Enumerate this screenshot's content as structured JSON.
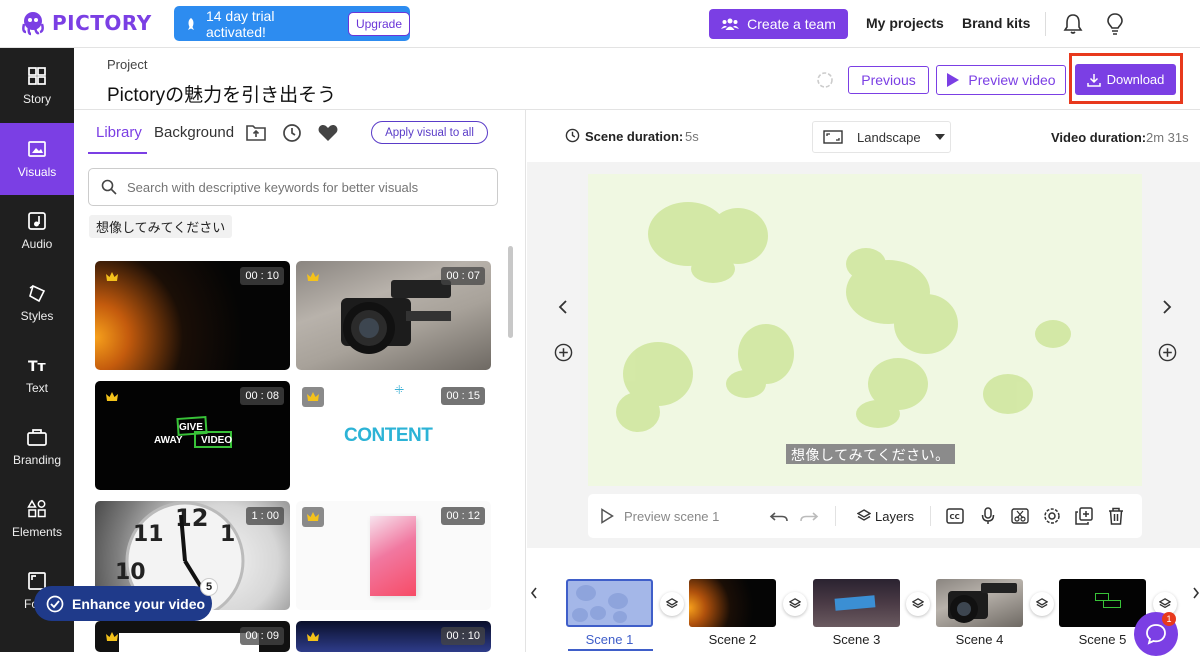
{
  "app": {
    "name": "PICTORY"
  },
  "topbar": {
    "trial_text": "14 day trial activated!",
    "upgrade_label": "Upgrade",
    "create_team_label": "Create a team",
    "my_projects_label": "My projects",
    "brand_kits_label": "Brand kits"
  },
  "sidebar": {
    "items": [
      {
        "label": "Story",
        "icon": "story-icon"
      },
      {
        "label": "Visuals",
        "icon": "visuals-icon"
      },
      {
        "label": "Audio",
        "icon": "audio-icon"
      },
      {
        "label": "Styles",
        "icon": "styles-icon"
      },
      {
        "label": "Text",
        "icon": "text-icon"
      },
      {
        "label": "Branding",
        "icon": "branding-icon"
      },
      {
        "label": "Elements",
        "icon": "elements-icon"
      },
      {
        "label": "Format",
        "icon": "format-icon"
      }
    ],
    "active": "Visuals"
  },
  "project": {
    "label": "Project",
    "title": "Pictoryの魅力を引き出そう",
    "previous_label": "Previous",
    "preview_video_label": "Preview video",
    "download_label": "Download"
  },
  "media": {
    "tabs": [
      "Library",
      "Background"
    ],
    "apply_visual_label": "Apply visual to all",
    "search_placeholder": "Search with descriptive keywords for better visuals",
    "keyword_chip": "想像してみてください",
    "thumbnails": [
      {
        "duration": "00 : 10"
      },
      {
        "duration": "00 : 07"
      },
      {
        "duration": "00 : 08",
        "text": [
          "GIVE",
          "AWAY",
          "VIDEO"
        ]
      },
      {
        "duration": "00 : 15",
        "text": "CONTENT"
      },
      {
        "duration": "1 : 00"
      },
      {
        "duration": "00 : 12"
      },
      {
        "duration": "00 : 09"
      },
      {
        "duration": "00 : 10"
      }
    ],
    "enhance_label": "Enhance your video",
    "enhance_badge": "5"
  },
  "editor": {
    "scene_duration_label": "Scene duration:",
    "scene_duration_value": "5s",
    "orientation": "Landscape",
    "video_duration_label": "Video duration:",
    "video_duration_value": "2m 31s",
    "caption": "想像してみてください。",
    "preview_scene_label": "Preview scene 1",
    "layers_label": "Layers"
  },
  "filmstrip": {
    "scenes": [
      "Scene 1",
      "Scene 2",
      "Scene 3",
      "Scene 4",
      "Scene 5"
    ],
    "active": "Scene 1"
  },
  "chat": {
    "badge": "1"
  },
  "colors": {
    "brand": "#7b3fe4",
    "trial": "#2d8cf0",
    "highlight": "#e8391d",
    "nav_bg": "#1f1f1f"
  }
}
